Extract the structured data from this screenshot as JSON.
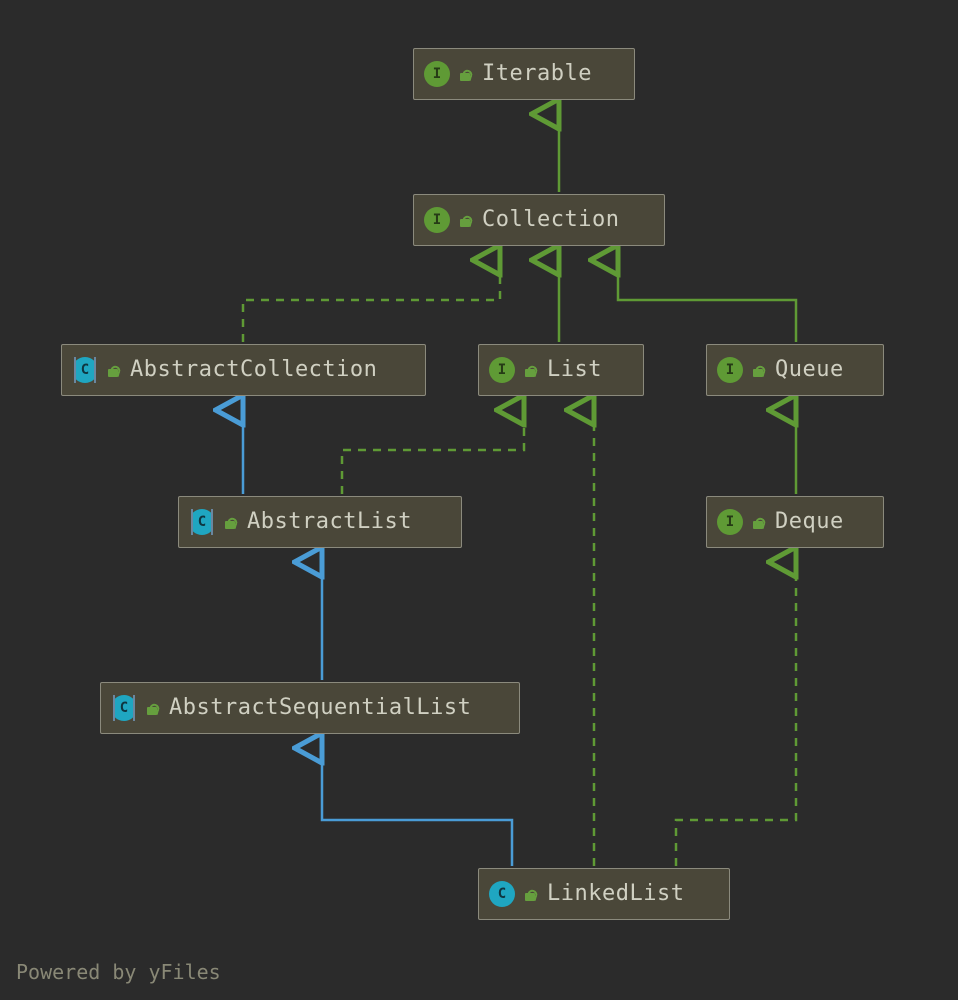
{
  "nodes": {
    "iterable": {
      "label": "Iterable",
      "kind": "interface"
    },
    "collection": {
      "label": "Collection",
      "kind": "interface"
    },
    "abscoll": {
      "label": "AbstractCollection",
      "kind": "abstract-class"
    },
    "list": {
      "label": "List",
      "kind": "interface"
    },
    "queue": {
      "label": "Queue",
      "kind": "interface"
    },
    "abslist": {
      "label": "AbstractList",
      "kind": "abstract-class"
    },
    "deque": {
      "label": "Deque",
      "kind": "interface"
    },
    "absseqlist": {
      "label": "AbstractSequentialList",
      "kind": "abstract-class"
    },
    "linkedlist": {
      "label": "LinkedList",
      "kind": "class"
    }
  },
  "edges": [
    {
      "from": "collection",
      "to": "iterable",
      "type": "extends-interface"
    },
    {
      "from": "abscoll",
      "to": "collection",
      "type": "implements"
    },
    {
      "from": "list",
      "to": "collection",
      "type": "extends-interface"
    },
    {
      "from": "queue",
      "to": "collection",
      "type": "extends-interface"
    },
    {
      "from": "abslist",
      "to": "abscoll",
      "type": "extends-class"
    },
    {
      "from": "abslist",
      "to": "list",
      "type": "implements"
    },
    {
      "from": "deque",
      "to": "queue",
      "type": "extends-interface"
    },
    {
      "from": "absseqlist",
      "to": "abslist",
      "type": "extends-class"
    },
    {
      "from": "linkedlist",
      "to": "absseqlist",
      "type": "extends-class"
    },
    {
      "from": "linkedlist",
      "to": "list",
      "type": "implements"
    },
    {
      "from": "linkedlist",
      "to": "deque",
      "type": "implements"
    }
  ],
  "attribution": "Powered by yFiles",
  "colors": {
    "background": "#2b2b2b",
    "node_fill": "#4a4739",
    "node_stroke": "#8b8a7d",
    "text": "#d0d0c2",
    "interface_green": "#5f9a35",
    "class_cyan": "#1fa6c1",
    "extends_blue": "#4a9cd6"
  }
}
